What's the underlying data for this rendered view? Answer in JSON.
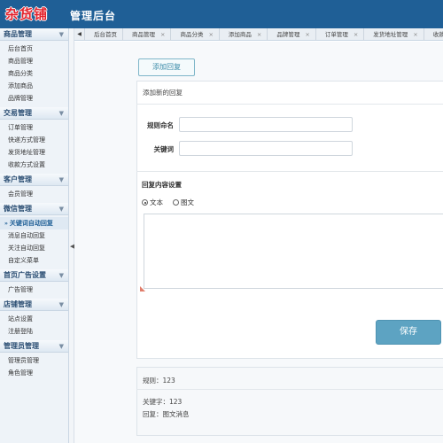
{
  "header": {
    "logo": "杂货铺",
    "title": "管理后台"
  },
  "sidebar": {
    "groups": [
      {
        "title": "商品管理",
        "items": [
          "后台首页",
          "商品管理",
          "商品分类",
          "添加商品",
          "品牌管理"
        ]
      },
      {
        "title": "交易管理",
        "items": [
          "订单管理",
          "快递方式管理",
          "发货地址管理",
          "收款方式设置"
        ]
      },
      {
        "title": "客户管理",
        "items": [
          "会员管理"
        ]
      },
      {
        "title": "微信管理",
        "items": [
          "关键词自动回复",
          "消息自动回复",
          "关注自动回复",
          "自定义菜单"
        ]
      },
      {
        "title": "首页广告设置",
        "items": [
          "广告管理"
        ]
      },
      {
        "title": "店铺管理",
        "items": [
          "站点设置",
          "注册登陆"
        ]
      },
      {
        "title": "管理员管理",
        "items": [
          "管理员管理",
          "角色管理"
        ]
      }
    ],
    "active_item": "关键词自动回复"
  },
  "tabs": [
    "后台首页",
    "商品管理",
    "商品分类",
    "添加商品",
    "品牌管理",
    "订单管理",
    "发货地址管理",
    "收款方"
  ],
  "main": {
    "add_reply_button": "添加回复",
    "section_title": "添加新的回复",
    "rule_name_label": "规则命名",
    "rule_name_value": "",
    "keyword_label": "关键词",
    "keyword_value": "",
    "content_heading": "回复内容设置",
    "radio_text": "文本",
    "radio_image_text": "图文",
    "selected_type": "文本",
    "save_button": "保存"
  },
  "summary": {
    "rule": "规则：123",
    "keyword": "关键字：123",
    "reply": "回复：图文消息"
  },
  "colors": {
    "header_bg": "#1f5f96",
    "logo": "#e4212b",
    "save_button": "#5da3c2",
    "sidebar_bg": "#eef3f8"
  }
}
